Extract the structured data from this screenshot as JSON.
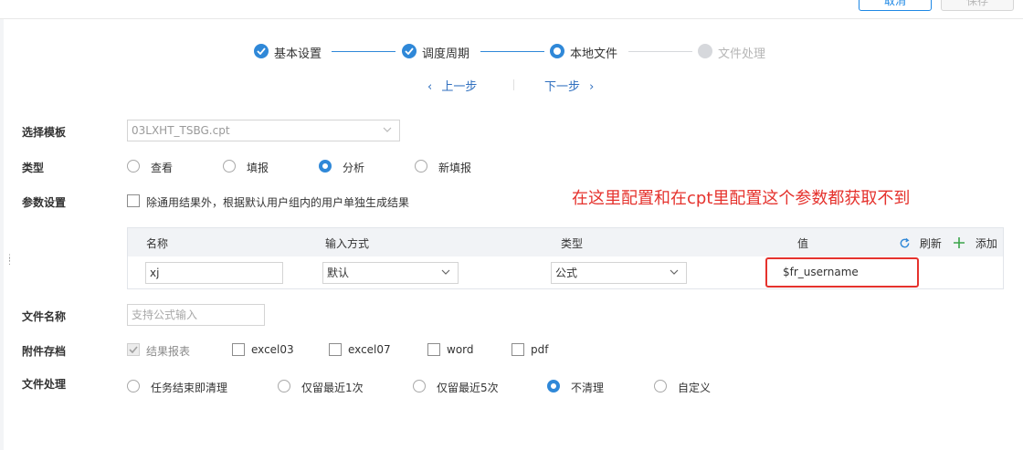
{
  "header": {
    "cancel_label": "取消",
    "save_label": "保存"
  },
  "steps": [
    {
      "label": "基本设置",
      "state": "done"
    },
    {
      "label": "调度周期",
      "state": "done"
    },
    {
      "label": "本地文件",
      "state": "current"
    },
    {
      "label": "文件处理",
      "state": "pending"
    }
  ],
  "nav": {
    "prev_label": "上一步",
    "next_label": "下一步"
  },
  "template": {
    "label": "选择模板",
    "value": "03LXHT_TSBG.cpt"
  },
  "type": {
    "label": "类型",
    "options": [
      "查看",
      "填报",
      "分析",
      "新填报"
    ],
    "selected": "分析"
  },
  "params": {
    "label": "参数设置",
    "checkbox_label": "除通用结果外，根据默认用户组内的用户单独生成结果",
    "columns": [
      "名称",
      "输入方式",
      "类型",
      "值"
    ],
    "refresh_label": "刷新",
    "add_label": "添加",
    "rows": [
      {
        "name": "xj",
        "input_mode": "默认",
        "type": "公式",
        "value": "$fr_username"
      }
    ]
  },
  "filename": {
    "label": "文件名称",
    "placeholder": "支持公式输入"
  },
  "attachments": {
    "label": "附件存档",
    "options": [
      {
        "label": "结果报表",
        "checked": true,
        "disabled": true
      },
      {
        "label": "excel03",
        "checked": false
      },
      {
        "label": "excel07",
        "checked": false
      },
      {
        "label": "word",
        "checked": false
      },
      {
        "label": "pdf",
        "checked": false
      }
    ]
  },
  "file_processing": {
    "label": "文件处理",
    "options": [
      "任务结束即清理",
      "仅留最近1次",
      "仅留最近5次",
      "不清理",
      "自定义"
    ],
    "selected": "不清理"
  },
  "annotation": {
    "text": "在这里配置和在cpt里配置这个参数都获取不到",
    "color": "#e5322d"
  },
  "colors": {
    "accent": "#2f88d8",
    "annotation": "#e5322d"
  }
}
